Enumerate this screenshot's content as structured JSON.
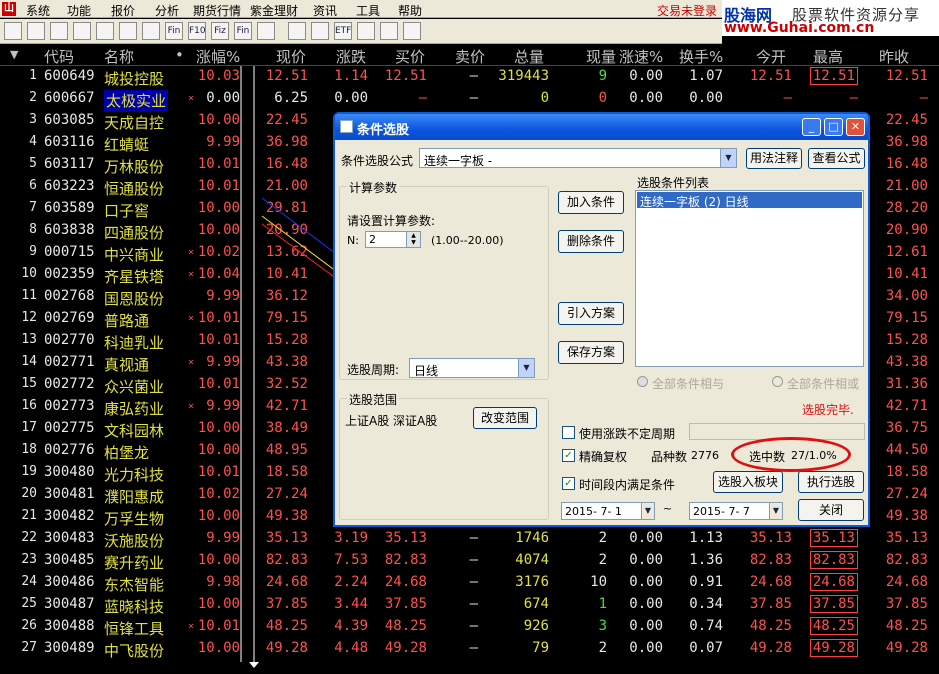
{
  "menubar": {
    "items": [
      "系统",
      "功能",
      "报价",
      "分析",
      "期货行情",
      "紫金理财",
      "资讯",
      "工具",
      "帮助"
    ],
    "status": "交易未登录"
  },
  "watermark": {
    "site": "股海网",
    "tagline": "股票软件资源分享",
    "url": "www.Guhai.com.cn"
  },
  "toolbar": {
    "icons": [
      "back-icon",
      "up-icon",
      "down-icon",
      "report-icon",
      "grid-icon",
      "grid-icon",
      "chart-icon",
      "fin-icon",
      "f10-icon",
      "fiz-icon",
      "fin-icon",
      "zoom-icon",
      "folder-icon",
      "quote-icon",
      "etf-icon",
      "export-icon",
      "print-icon",
      "gear-icon"
    ],
    "labels": [
      "",
      "",
      "",
      "",
      "",
      "",
      "",
      "Fin",
      "F10",
      "Fiz",
      "Fin",
      "",
      "",
      "",
      "ETF",
      "",
      "",
      ""
    ]
  },
  "table": {
    "headers": [
      "代码",
      "名称",
      "•",
      "涨幅%",
      "现价",
      "涨跌",
      "买价",
      "卖价",
      "总量",
      "现量",
      "涨速%",
      "换手%",
      "今开",
      "最高",
      "昨收"
    ],
    "rows": [
      {
        "n": "1",
        "code": "600649",
        "name": "城投控股",
        "mark": "",
        "pct": "10.03",
        "price": "12.51",
        "chg": "1.14",
        "bid": "12.51",
        "ask": "–",
        "vol": "319443",
        "cur": "9",
        "spd": "0.00",
        "turn": "1.07",
        "open": "12.51",
        "high": "12.51",
        "close": "12.51"
      },
      {
        "n": "2",
        "code": "600667",
        "name": "太极实业",
        "mark": "×",
        "pct": "0.00",
        "price": "6.25",
        "chg": "0.00",
        "bid": "–",
        "ask": "–",
        "vol": "0",
        "cur": "0",
        "spd": "0.00",
        "turn": "0.00",
        "open": "–",
        "high": "–",
        "close": "–"
      },
      {
        "n": "3",
        "code": "603085",
        "name": "天成自控",
        "mark": "",
        "pct": "10.00",
        "price": "22.45",
        "chg": "",
        "bid": "",
        "ask": "",
        "vol": "",
        "cur": "",
        "spd": "",
        "turn": "",
        "open": "",
        "high": "",
        "close": "22.45"
      },
      {
        "n": "4",
        "code": "603116",
        "name": "红蜻蜓",
        "mark": "",
        "pct": "9.99",
        "price": "36.98",
        "chg": "",
        "bid": "",
        "ask": "",
        "vol": "",
        "cur": "",
        "spd": "",
        "turn": "",
        "open": "",
        "high": "",
        "close": "36.98"
      },
      {
        "n": "5",
        "code": "603117",
        "name": "万林股份",
        "mark": "",
        "pct": "10.01",
        "price": "16.48",
        "chg": "",
        "bid": "",
        "ask": "",
        "vol": "",
        "cur": "",
        "spd": "",
        "turn": "",
        "open": "",
        "high": "",
        "close": "16.48"
      },
      {
        "n": "6",
        "code": "603223",
        "name": "恒通股份",
        "mark": "",
        "pct": "10.01",
        "price": "21.00",
        "chg": "",
        "bid": "",
        "ask": "",
        "vol": "",
        "cur": "",
        "spd": "",
        "turn": "",
        "open": "",
        "high": "",
        "close": "21.00"
      },
      {
        "n": "7",
        "code": "603589",
        "name": "口子窖",
        "mark": "",
        "pct": "10.00",
        "price": "29.81",
        "chg": "",
        "bid": "",
        "ask": "",
        "vol": "",
        "cur": "",
        "spd": "",
        "turn": "",
        "open": "",
        "high": "",
        "close": "28.20"
      },
      {
        "n": "8",
        "code": "603838",
        "name": "四通股份",
        "mark": "",
        "pct": "10.00",
        "price": "20.90",
        "chg": "",
        "bid": "",
        "ask": "",
        "vol": "",
        "cur": "",
        "spd": "",
        "turn": "",
        "open": "",
        "high": "",
        "close": "20.90"
      },
      {
        "n": "9",
        "code": "000715",
        "name": "中兴商业",
        "mark": "×",
        "pct": "10.02",
        "price": "13.62",
        "chg": "",
        "bid": "",
        "ask": "",
        "vol": "",
        "cur": "",
        "spd": "",
        "turn": "",
        "open": "",
        "high": "",
        "close": "12.61"
      },
      {
        "n": "10",
        "code": "002359",
        "name": "齐星铁塔",
        "mark": "×",
        "pct": "10.04",
        "price": "10.41",
        "chg": "",
        "bid": "",
        "ask": "",
        "vol": "",
        "cur": "",
        "spd": "",
        "turn": "",
        "open": "",
        "high": "",
        "close": "10.41"
      },
      {
        "n": "11",
        "code": "002768",
        "name": "国恩股份",
        "mark": "",
        "pct": "9.99",
        "price": "36.12",
        "chg": "",
        "bid": "",
        "ask": "",
        "vol": "",
        "cur": "",
        "spd": "",
        "turn": "",
        "open": "",
        "high": "",
        "close": "34.00"
      },
      {
        "n": "12",
        "code": "002769",
        "name": "普路通",
        "mark": "×",
        "pct": "10.01",
        "price": "79.15",
        "chg": "",
        "bid": "",
        "ask": "",
        "vol": "",
        "cur": "",
        "spd": "",
        "turn": "",
        "open": "",
        "high": "",
        "close": "79.15"
      },
      {
        "n": "13",
        "code": "002770",
        "name": "科迪乳业",
        "mark": "",
        "pct": "10.01",
        "price": "15.28",
        "chg": "",
        "bid": "",
        "ask": "",
        "vol": "",
        "cur": "",
        "spd": "",
        "turn": "",
        "open": "",
        "high": "",
        "close": "15.28"
      },
      {
        "n": "14",
        "code": "002771",
        "name": "真视通",
        "mark": "×",
        "pct": "9.99",
        "price": "43.38",
        "chg": "",
        "bid": "",
        "ask": "",
        "vol": "",
        "cur": "",
        "spd": "",
        "turn": "",
        "open": "",
        "high": "",
        "close": "43.38"
      },
      {
        "n": "15",
        "code": "002772",
        "name": "众兴菌业",
        "mark": "",
        "pct": "10.01",
        "price": "32.52",
        "chg": "",
        "bid": "",
        "ask": "",
        "vol": "",
        "cur": "",
        "spd": "",
        "turn": "",
        "open": "",
        "high": "",
        "close": "31.36"
      },
      {
        "n": "16",
        "code": "002773",
        "name": "康弘药业",
        "mark": "×",
        "pct": "9.99",
        "price": "42.71",
        "chg": "",
        "bid": "",
        "ask": "",
        "vol": "",
        "cur": "",
        "spd": "",
        "turn": "",
        "open": "",
        "high": "",
        "close": "42.71"
      },
      {
        "n": "17",
        "code": "002775",
        "name": "文科园林",
        "mark": "",
        "pct": "10.00",
        "price": "38.49",
        "chg": "",
        "bid": "",
        "ask": "",
        "vol": "",
        "cur": "",
        "spd": "",
        "turn": "",
        "open": "",
        "high": "",
        "close": "36.75"
      },
      {
        "n": "18",
        "code": "002776",
        "name": "柏堡龙",
        "mark": "",
        "pct": "10.00",
        "price": "48.95",
        "chg": "",
        "bid": "",
        "ask": "",
        "vol": "",
        "cur": "",
        "spd": "",
        "turn": "",
        "open": "",
        "high": "",
        "close": "44.50"
      },
      {
        "n": "19",
        "code": "300480",
        "name": "光力科技",
        "mark": "",
        "pct": "10.01",
        "price": "18.58",
        "chg": "",
        "bid": "",
        "ask": "",
        "vol": "",
        "cur": "",
        "spd": "",
        "turn": "",
        "open": "",
        "high": "",
        "close": "18.58"
      },
      {
        "n": "20",
        "code": "300481",
        "name": "濮阳惠成",
        "mark": "",
        "pct": "10.02",
        "price": "27.24",
        "chg": "",
        "bid": "",
        "ask": "",
        "vol": "",
        "cur": "",
        "spd": "",
        "turn": "",
        "open": "",
        "high": "",
        "close": "27.24"
      },
      {
        "n": "21",
        "code": "300482",
        "name": "万孚生物",
        "mark": "",
        "pct": "10.00",
        "price": "49.38",
        "chg": "",
        "bid": "",
        "ask": "",
        "vol": "",
        "cur": "",
        "spd": "",
        "turn": "",
        "open": "",
        "high": "",
        "close": "49.38"
      },
      {
        "n": "22",
        "code": "300483",
        "name": "沃施股份",
        "mark": "",
        "pct": "9.99",
        "price": "35.13",
        "chg": "3.19",
        "bid": "35.13",
        "ask": "–",
        "vol": "1746",
        "cur": "2",
        "spd": "0.00",
        "turn": "1.13",
        "open": "35.13",
        "high": "35.13",
        "close": "35.13"
      },
      {
        "n": "23",
        "code": "300485",
        "name": "赛升药业",
        "mark": "",
        "pct": "10.00",
        "price": "82.83",
        "chg": "7.53",
        "bid": "82.83",
        "ask": "–",
        "vol": "4074",
        "cur": "2",
        "spd": "0.00",
        "turn": "1.36",
        "open": "82.83",
        "high": "82.83",
        "close": "82.83"
      },
      {
        "n": "24",
        "code": "300486",
        "name": "东杰智能",
        "mark": "",
        "pct": "9.98",
        "price": "24.68",
        "chg": "2.24",
        "bid": "24.68",
        "ask": "–",
        "vol": "3176",
        "cur": "10",
        "spd": "0.00",
        "turn": "0.91",
        "open": "24.68",
        "high": "24.68",
        "close": "24.68"
      },
      {
        "n": "25",
        "code": "300487",
        "name": "蓝晓科技",
        "mark": "",
        "pct": "10.00",
        "price": "37.85",
        "chg": "3.44",
        "bid": "37.85",
        "ask": "–",
        "vol": "674",
        "cur": "1",
        "spd": "0.00",
        "turn": "0.34",
        "open": "37.85",
        "high": "37.85",
        "close": "37.85"
      },
      {
        "n": "26",
        "code": "300488",
        "name": "恒锋工具",
        "mark": "×",
        "pct": "10.01",
        "price": "48.25",
        "chg": "4.39",
        "bid": "48.25",
        "ask": "–",
        "vol": "926",
        "cur": "3",
        "spd": "0.00",
        "turn": "0.74",
        "open": "48.25",
        "high": "48.25",
        "close": "48.25"
      },
      {
        "n": "27",
        "code": "300489",
        "name": "中飞股份",
        "mark": "",
        "pct": "10.00",
        "price": "49.28",
        "chg": "4.48",
        "bid": "49.28",
        "ask": "–",
        "vol": "79",
        "cur": "2",
        "spd": "0.00",
        "turn": "0.07",
        "open": "49.28",
        "high": "49.28",
        "close": "49.28"
      }
    ]
  },
  "dialog": {
    "title": "条件选股",
    "formula_label": "条件选股公式",
    "formula_value": "连续一字板 -",
    "usage_btn": "用法注释",
    "view_btn": "查看公式",
    "params_group": "计算参数",
    "params_prompt": "请设置计算参数:",
    "n_label": "N:",
    "n_value": "2",
    "n_range": "(1.00--20.00)",
    "add_btn": "加入条件",
    "del_btn": "删除条件",
    "import_btn": "引入方案",
    "save_btn": "保存方案",
    "list_label": "选股条件列表",
    "list_items": [
      "连续一字板 (2) 日线"
    ],
    "period_label": "选股周期:",
    "period_value": "日线",
    "and_label": "全部条件相与",
    "or_label": "全部条件相或",
    "scope_group": "选股范围",
    "scope_value": "上证A股 深证A股",
    "change_scope_btn": "改变范围",
    "done_text": "选股完毕.",
    "chk_unsettled": "使用涨跌不定周期",
    "chk_exact": "精确复权",
    "count_label": "品种数",
    "count_value": "2776",
    "selected_label": "选中数",
    "selected_value": "27/1.0%",
    "chk_period": "时间段内满足条件",
    "to_board_btn": "选股入板块",
    "exec_btn": "执行选股",
    "date_from": "2015- 7- 1",
    "date_to": "2015- 7- 7",
    "close_btn": "关闭"
  }
}
